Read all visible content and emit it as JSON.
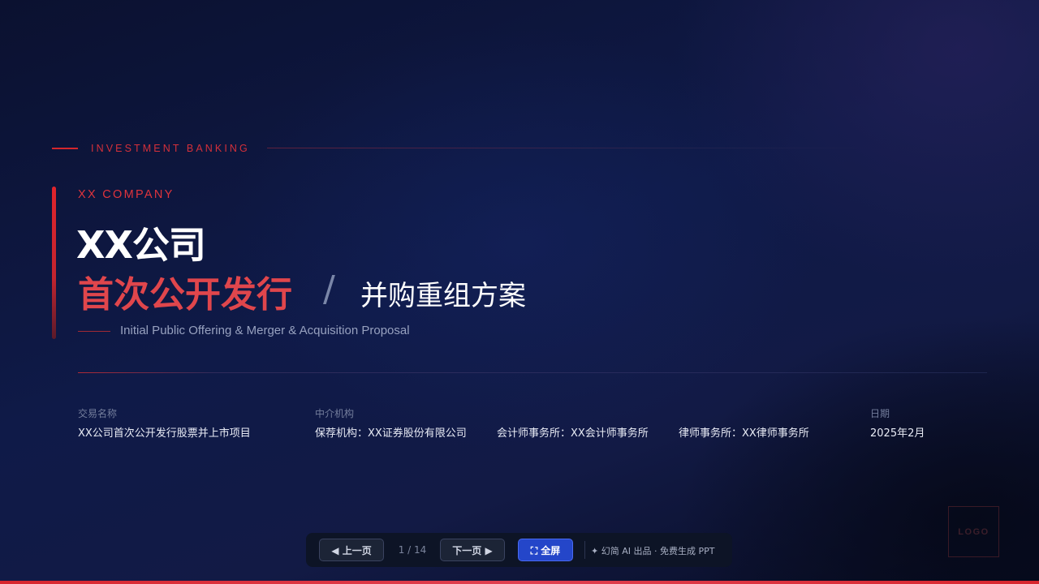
{
  "header": {
    "category": "INVESTMENT BANKING"
  },
  "title": {
    "company_en": "XX COMPANY",
    "company_cn": "XX公司",
    "subtitle_red": "首次公开发行",
    "separator": "/",
    "subtitle_white": "并购重组方案",
    "english": "Initial Public Offering & Merger & Acquisition Proposal"
  },
  "info": {
    "deal_label": "交易名称",
    "deal_value": "XX公司首次公开发行股票并上市项目",
    "intermediary_label": "中介机构",
    "sponsor": "保荐机构：XX证券股份有限公司",
    "accountant": "会计师事务所：XX会计师事务所",
    "law_firm": "律师事务所：XX律师事务所",
    "date_label": "日期",
    "date_value": "2025年2月"
  },
  "logo": {
    "text": "LOGO"
  },
  "nav": {
    "prev_label": "◀ 上一页",
    "page_indicator": "1 / 14",
    "next_label": "下一页 ▶",
    "fullscreen_label": "⛶ 全屏",
    "credit": "✦ 幻简 AI 出品 · 免费生成 PPT"
  },
  "colors": {
    "accent_red": "#d4262c",
    "background": "#0f1a48",
    "fullscreen_blue": "#2446c9"
  }
}
